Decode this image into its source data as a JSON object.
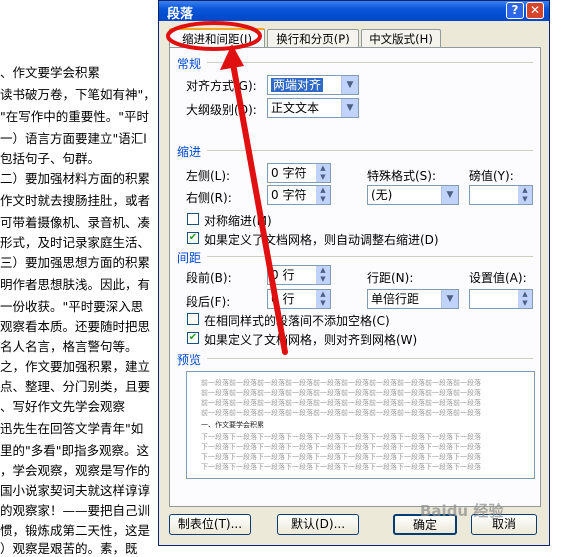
{
  "document": {
    "lines": [
      "、作文要学会积累",
      "读书破万卷，下笔如有神\"，",
      "\"在写作中的重要性。\"平时",
      "一）语言方面要建立\"语汇l",
      "包括句子、句群。",
      "二）要加强材料方面的积累",
      "作文时就去搜肠挂肚，或者",
      "可带着摄像机、录音机、凑",
      "形式，及时记录家庭生活、",
      "三）要加强思想方面的积累",
      "明作者思想肤浅。因此，有",
      "一份收获。\"平时要深入思",
      "观察看本质。还要随时把思",
      "名人名言，格言警句等。",
      "之，作文要加强积累，建立",
      "点、整理、分门别类，且要",
      "、写好作文先学会观察",
      "迅先生在回答文学青年\"如",
      "里的\"多看\"即指多观察。这",
      "，学会观察，观察是写作的",
      "国小说家契诃夫就这样谆谆",
      "的观察家！——要把自己训",
      "惯，锻炼成第二天性，这是",
      "）观察是艰苦的。素，既"
    ]
  },
  "dialog": {
    "title": "段落",
    "help_label": "?",
    "close_label": "✕",
    "tabs": [
      {
        "label": "缩进和间距(I)"
      },
      {
        "label": "换行和分页(P)"
      },
      {
        "label": "中文版式(H)"
      }
    ],
    "general": {
      "section_label": "常规",
      "alignment_label": "对齐方式(G):",
      "alignment_value": "两端对齐",
      "outline_label": "大纲级别(O):",
      "outline_value": "正文文本"
    },
    "indent": {
      "section_label": "缩进",
      "left_label": "左侧(L):",
      "left_value": "0 字符",
      "right_label": "右侧(R):",
      "right_value": "0 字符",
      "special_label": "特殊格式(S):",
      "special_value": "(无)",
      "by_label": "磅值(Y):",
      "mirror_label": "对称缩进(M)",
      "mirror_checked": false,
      "auto_adjust_label": "如果定义了文档网格，则自动调整右缩进(D)",
      "auto_adjust_checked": true
    },
    "spacing": {
      "section_label": "间距",
      "before_label": "段前(B):",
      "before_value": "0 行",
      "after_label": "段后(F):",
      "after_value": "0 行",
      "line_label": "行距(N):",
      "line_value": "单倍行距",
      "at_label": "设置值(A):",
      "no_space_label": "在相同样式的段落间不添加空格(C)",
      "no_space_checked": false,
      "snap_grid_label": "如果定义了文档网格，则对齐到网格(W)",
      "snap_grid_checked": true
    },
    "preview": {
      "section_label": "预览",
      "prev_text": "前一段落前一段落前一段落前一段落前一段落前一段落前一段落前一段落前一段落前一段落",
      "sample_text": "一、作文要学会积累",
      "next_text": "下一段落下一段落下一段落下一段落下一段落下一段落下一段落下一段落下一段落下一段落"
    },
    "buttons": {
      "tabs": "制表位(T)...",
      "default": "默认(D)...",
      "ok": "确定",
      "cancel": "取消"
    }
  },
  "watermark": "Baidu 经验",
  "colors": {
    "annotation_red": "#e01010",
    "title_blue": "#0a55d8",
    "section_blue": "#0046d5"
  }
}
